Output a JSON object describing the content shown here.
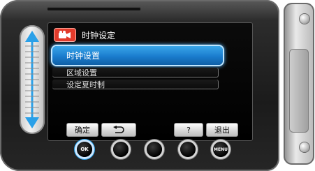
{
  "screen": {
    "title": "时钟设定",
    "menu_items": [
      {
        "label": "时钟设置",
        "selected": true
      },
      {
        "label": "区域设置",
        "selected": false
      },
      {
        "label": "设定夏时制",
        "selected": false
      }
    ]
  },
  "softkeys": {
    "confirm": "确定",
    "back_icon": "return-arrow-icon",
    "help": "?",
    "exit": "退出"
  },
  "hardware_buttons": {
    "ok": "OK",
    "menu": "MENU"
  },
  "colors": {
    "highlight": "#1a7ccd",
    "camera_badge": "#e23b2b"
  }
}
